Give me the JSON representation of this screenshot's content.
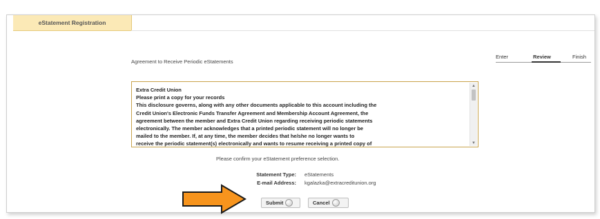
{
  "tabs": [
    {
      "label": "eStatement Registration"
    }
  ],
  "steps": {
    "enter": "Enter",
    "review": "Review",
    "finish": "Finish"
  },
  "agreement": {
    "title": "Agreement to Receive Periodic eStatements",
    "lines": [
      "Extra Credit Union",
      "Please print a copy for your records",
      "This disclosure governs, along with any other documents applicable to this account including the",
      "Credit Union's Electronic Funds Transfer Agreement and Membership Account Agreement, the",
      "agreement between the member and Extra Credit Union regarding receiving periodic statements",
      "electronically. The member acknowledges that a printed periodic statement will no longer be",
      "mailed to the member. If, at any time, the member decides that he/she no longer wants to",
      "receive the periodic statement(s) electronically and wants to resume receiving a printed copy of"
    ]
  },
  "confirmation": {
    "prompt": "Please confirm your eStatement preference selection.",
    "statement_type_label": "Statement Type:",
    "statement_type_value": "eStatements",
    "email_label": "E-mail Address:",
    "email_value": "kgalazka@extracreditunion.org"
  },
  "buttons": {
    "submit": "Submit",
    "cancel": "Cancel"
  },
  "colors": {
    "tab_background": "#fbe9b6",
    "arrow": "#f7941d",
    "border_accent": "#c8a24a"
  },
  "icons": {
    "submit": "circle-arrow-icon",
    "cancel": "circle-arrow-icon",
    "annotation": "orange-arrow-icon"
  }
}
